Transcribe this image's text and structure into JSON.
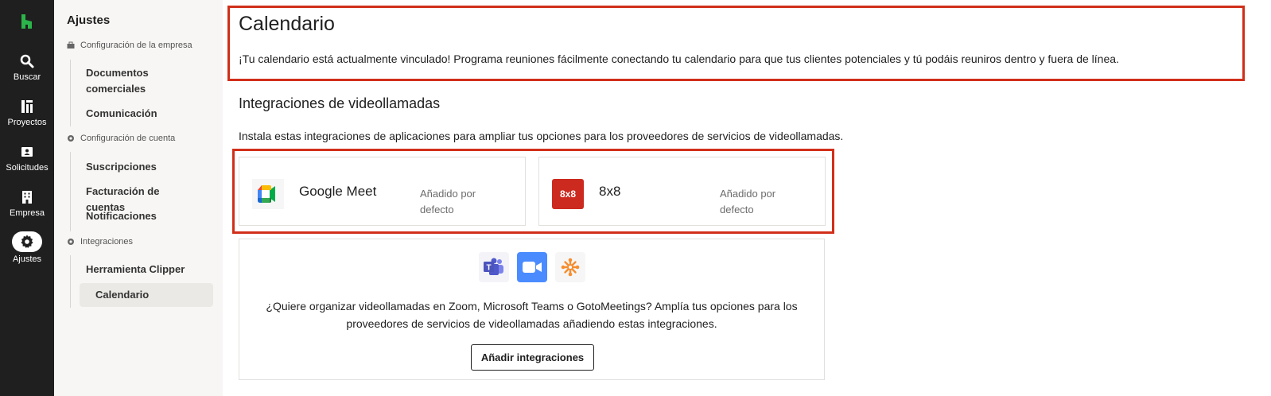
{
  "nav": {
    "items": [
      {
        "label": "Buscar",
        "icon": "search-icon"
      },
      {
        "label": "Proyectos",
        "icon": "projects-icon"
      },
      {
        "label": "Solicitudes",
        "icon": "requests-icon"
      },
      {
        "label": "Empresa",
        "icon": "building-icon"
      },
      {
        "label": "Ajustes",
        "icon": "gear-icon"
      }
    ]
  },
  "sidebar": {
    "title": "Ajustes",
    "sections": [
      {
        "label": "Configuración de la empresa",
        "icon": "briefcase-icon",
        "links": [
          "Documentos comerciales",
          "Comunicación"
        ]
      },
      {
        "label": "Configuración de cuenta",
        "icon": "gear-icon",
        "links": [
          "Suscripciones",
          "Facturación de cuentas",
          "Notificaciones"
        ]
      },
      {
        "label": "Integraciones",
        "icon": "gear-icon",
        "links": [
          "Herramienta Clipper",
          "Calendario"
        ]
      }
    ]
  },
  "main": {
    "title": "Calendario",
    "description": "¡Tu calendario está actualmente vinculado! Programa reuniones fácilmente conectando tu calendario para que tus clientes potenciales y tú podáis reuniros dentro y fuera de línea.",
    "video_section": {
      "title": "Integraciones de videollamadas",
      "description": "Instala estas integraciones de aplicaciones para ampliar tus opciones para los proveedores de servicios de videollamadas.",
      "integrations": [
        {
          "name": "Google Meet",
          "status": "Añadido por defecto",
          "icon": "google-meet-icon"
        },
        {
          "name": "8x8",
          "status": "Añadido por defecto",
          "icon": "8x8-icon",
          "icon_text": "8x8"
        }
      ],
      "promo": {
        "icons": [
          "microsoft-teams-icon",
          "zoom-icon",
          "gotomeeting-icon"
        ],
        "text": "¿Quiere organizar videollamadas en Zoom, Microsoft Teams o GotoMeetings? Amplía tus opciones para los proveedores de servicios de videollamadas añadiendo estas integraciones.",
        "button_label": "Añadir integraciones"
      }
    }
  },
  "colors": {
    "nav_bg": "#1f1f1f",
    "logo": "#2bb44a",
    "highlight": "#d12f1a",
    "badge_8x8": "#cc2a1f",
    "zoom": "#4a8cff"
  }
}
